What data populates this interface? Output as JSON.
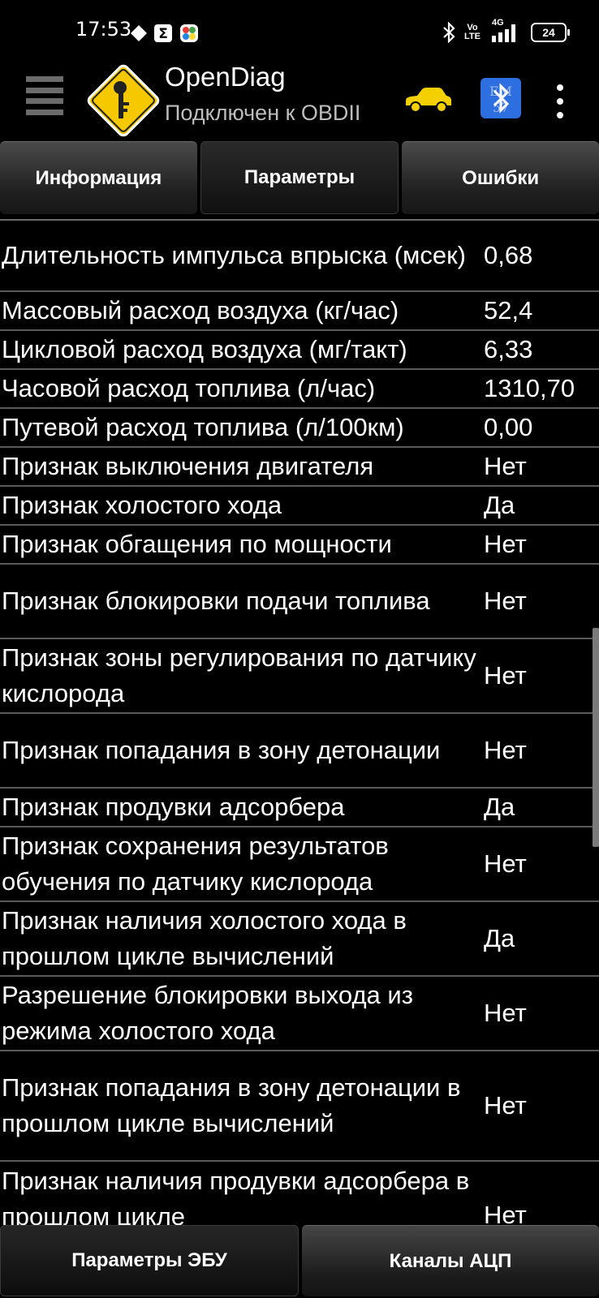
{
  "status_bar": {
    "time": "17:53",
    "network_label_top": "Vo",
    "network_label_bottom": "LTE",
    "network_gen": "4G",
    "battery": "24",
    "icons": [
      "diamond-icon",
      "sigma-icon",
      "colorful-app-icon",
      "bluetooth-icon",
      "signal-icon",
      "battery-icon"
    ]
  },
  "action_bar": {
    "title": "OpenDiag",
    "subtitle": "Подключен к OBDII",
    "colors": {
      "logo_yellow": "#f5c800",
      "car_yellow": "#f5d000",
      "ecu_blue": "#2d6fe0"
    }
  },
  "tabs": [
    {
      "label": "Информация",
      "active": false
    },
    {
      "label": "Параметры",
      "active": true
    },
    {
      "label": "Ошибки",
      "active": false
    }
  ],
  "parameters": [
    {
      "name": "Длительность импульса впрыска (мсек)",
      "value": "0,68"
    },
    {
      "name": "Массовый расход воздуха (кг/час)",
      "value": "52,4"
    },
    {
      "name": "Цикловой расход воздуха (мг/такт)",
      "value": "6,33"
    },
    {
      "name": "Часовой расход топлива (л/час)",
      "value": "1310,70"
    },
    {
      "name": "Путевой расход топлива (л/100км)",
      "value": "0,00"
    },
    {
      "name": "Признак выключения двигателя",
      "value": "Нет"
    },
    {
      "name": "Признак холостого хода",
      "value": "Да"
    },
    {
      "name": "Признак обгащения по мощности",
      "value": "Нет"
    },
    {
      "name": "Признак блокировки подачи топлива",
      "value": "Нет"
    },
    {
      "name": "Признак зоны регулирования по датчику кислорода",
      "value": "Нет"
    },
    {
      "name": "Признак попадания в зону детонации",
      "value": "Нет"
    },
    {
      "name": "Признак продувки адсорбера",
      "value": "Да"
    },
    {
      "name": "Признак сохранения результатов обучения по датчику кислорода",
      "value": "Нет"
    },
    {
      "name": "Признак наличия холостого хода в прошлом цикле вычислений",
      "value": "Да"
    },
    {
      "name": "Разрешение блокировки выхода из режима холостого хода",
      "value": "Нет"
    },
    {
      "name": "Признак попадания в зону детонации в прошлом цикле вычислений",
      "value": "Нет"
    },
    {
      "name": "Признак наличия продувки адсорбера в прошлом цикле",
      "value": "Нет"
    }
  ],
  "bottom_tabs": [
    {
      "label": "Параметры ЭБУ",
      "active": true
    },
    {
      "label": "Каналы АЦП",
      "active": false
    }
  ]
}
